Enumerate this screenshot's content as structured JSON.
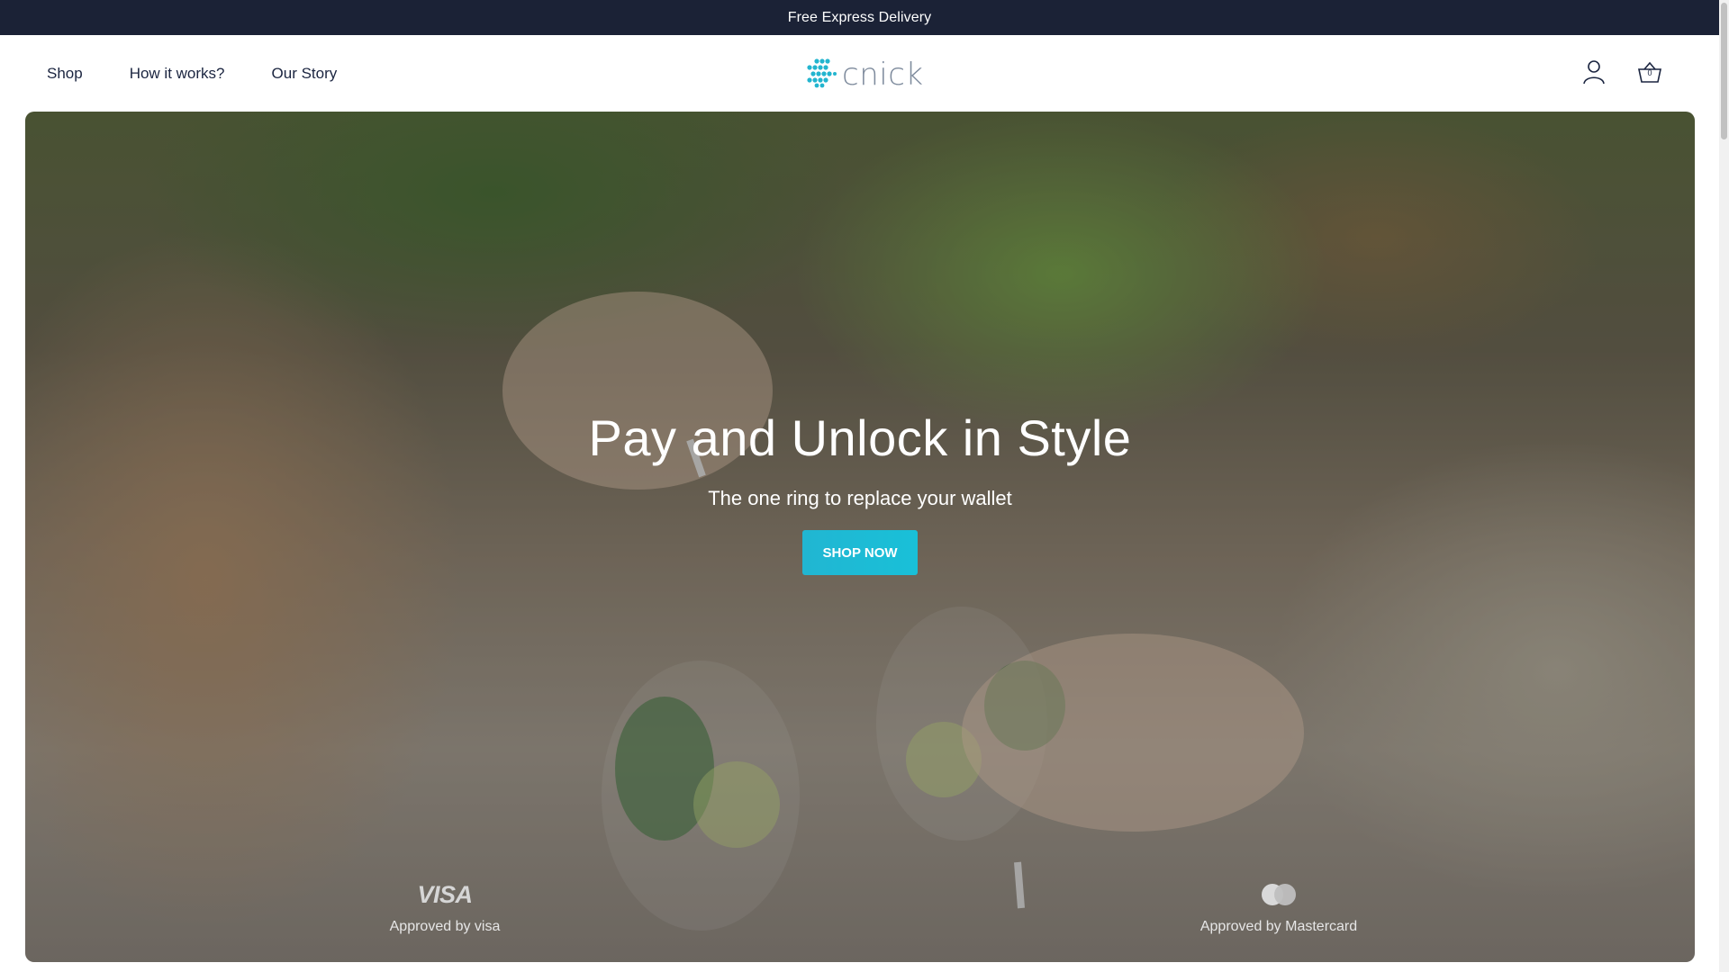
{
  "announcement": {
    "text": "Free Express Delivery"
  },
  "nav": {
    "items": [
      {
        "label": "Shop"
      },
      {
        "label": "How it works?"
      },
      {
        "label": "Our Story"
      }
    ]
  },
  "brand": {
    "name": "cnick",
    "color": "#7d8a9c",
    "accent": "#23b5cf"
  },
  "header_icons": {
    "account_icon": "user-icon",
    "cart_icon": "basket-icon",
    "cart_count": "0"
  },
  "hero": {
    "title": "Pay and Unlock in Style",
    "subtitle": "The one ring to replace your wallet",
    "cta_label": "SHOP NOW",
    "cta_color": "#1fb8d3"
  },
  "badges": [
    {
      "logo": "VISA",
      "label": "Approved by visa"
    },
    {
      "logo": "mastercard-icon",
      "label": "Approved by Mastercard"
    }
  ],
  "colors": {
    "topbar": "#1b2236",
    "text": "#1b2540"
  }
}
